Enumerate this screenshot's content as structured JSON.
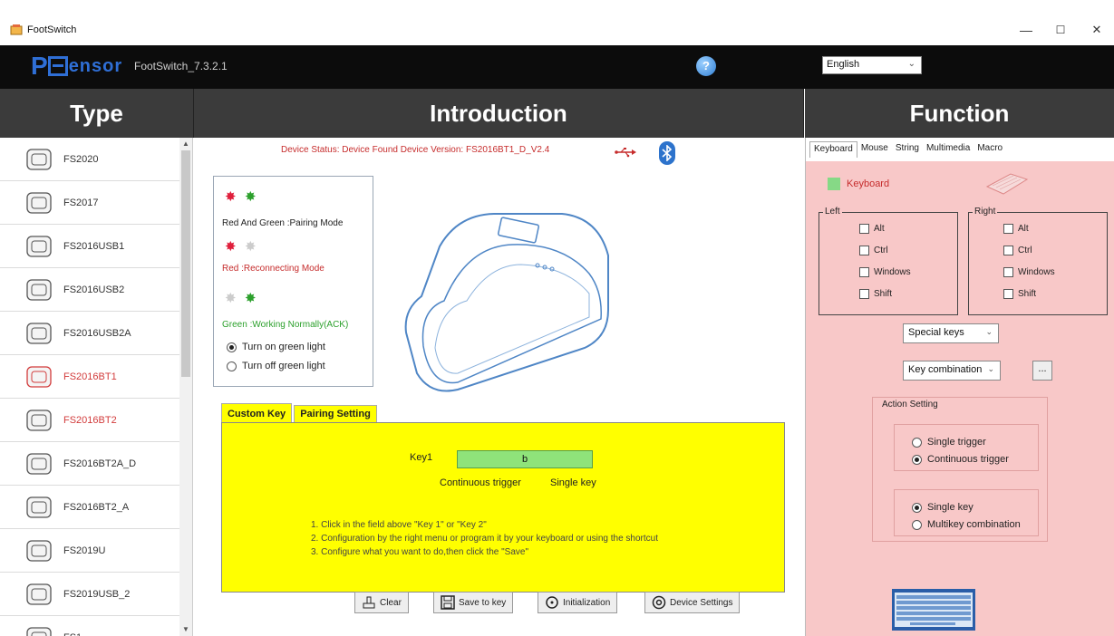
{
  "window": {
    "title": "FootSwitch",
    "minimize": "—",
    "maximize": "☐",
    "close": "✕"
  },
  "header": {
    "logo_p": "P",
    "logo_rest": "ensor",
    "app_version": "FootSwitch_7.3.2.1",
    "help_icon": "?",
    "language": "English"
  },
  "columns": {
    "type": "Type",
    "introduction": "Introduction",
    "function": "Function"
  },
  "type_list": [
    {
      "label": "FS2020",
      "icon": "triple-pedal-icon",
      "selected": false
    },
    {
      "label": "FS2017",
      "icon": "flat-pedal-icon",
      "selected": false
    },
    {
      "label": "FS2016USB1",
      "icon": "single-pedal-icon",
      "selected": false
    },
    {
      "label": "FS2016USB2",
      "icon": "double-pedal-icon",
      "selected": false
    },
    {
      "label": "FS2016USB2A",
      "icon": "arch-pedal-icon",
      "selected": false
    },
    {
      "label": "FS2016BT1",
      "icon": "bt-pedal-icon",
      "selected": true
    },
    {
      "label": "FS2016BT2",
      "icon": "double-pedal-icon",
      "selected": true
    },
    {
      "label": "FS2016BT2A_D",
      "icon": "double-pedal-icon",
      "selected": false
    },
    {
      "label": "FS2016BT2_A",
      "icon": "arch-pedal-icon",
      "selected": false
    },
    {
      "label": "FS2019U",
      "icon": "hand-switch-icon",
      "selected": false
    },
    {
      "label": "FS2019USB_2",
      "icon": "dual-round-icon",
      "selected": false
    },
    {
      "label": "FS1",
      "icon": "single-pedal-icon",
      "selected": false
    }
  ],
  "status": {
    "line": "Device Status:  Device Found     Device Version:  FS2016BT1_D_V2.4",
    "bt_icon": "ʙ"
  },
  "lights": {
    "pairing": "Red And Green :Pairing Mode",
    "reconnecting": "Red :Reconnecting Mode",
    "working": "Green :Working Normally(ACK)",
    "turn_on": "Turn on green light",
    "turn_off": "Turn off green light"
  },
  "tabs": [
    "Custom Key",
    "Pairing Setting"
  ],
  "custom_key": {
    "key1_label": "Key1",
    "key1_value": "b",
    "trigger": "Continuous trigger",
    "keytype": "Single key",
    "instructions": [
      "1. Click in the field above \"Key 1\" or \"Key 2\"",
      "2. Configuration by the right menu or program it by your keyboard or using the shortcut",
      "3. Configure what you want to do,then click the \"Save\""
    ]
  },
  "buttons": {
    "clear": "Clear",
    "save": "Save to key",
    "init": "Initialization",
    "settings": "Device Settings"
  },
  "function": {
    "tabs": [
      "Keyboard",
      "Mouse",
      "String",
      "Multimedia",
      "Macro"
    ],
    "keyboard_label": "Keyboard",
    "left_legend": "Left",
    "right_legend": "Right",
    "modifiers": [
      "Alt",
      "Ctrl",
      "Windows",
      "Shift"
    ],
    "special_keys": "Special keys",
    "key_combination": "Key combination",
    "dots": "...",
    "action_setting": "Action Setting",
    "single_trigger": "Single trigger",
    "continuous_trigger": "Continuous trigger",
    "single_key": "Single key",
    "multikey": "Multikey  combination"
  },
  "colors": {
    "accent": "#2f6fd6",
    "status_red": "#c62c2c",
    "panel_yellow": "#ffff00",
    "function_pink": "#f8c8c8",
    "key_green": "#8fe37a"
  }
}
